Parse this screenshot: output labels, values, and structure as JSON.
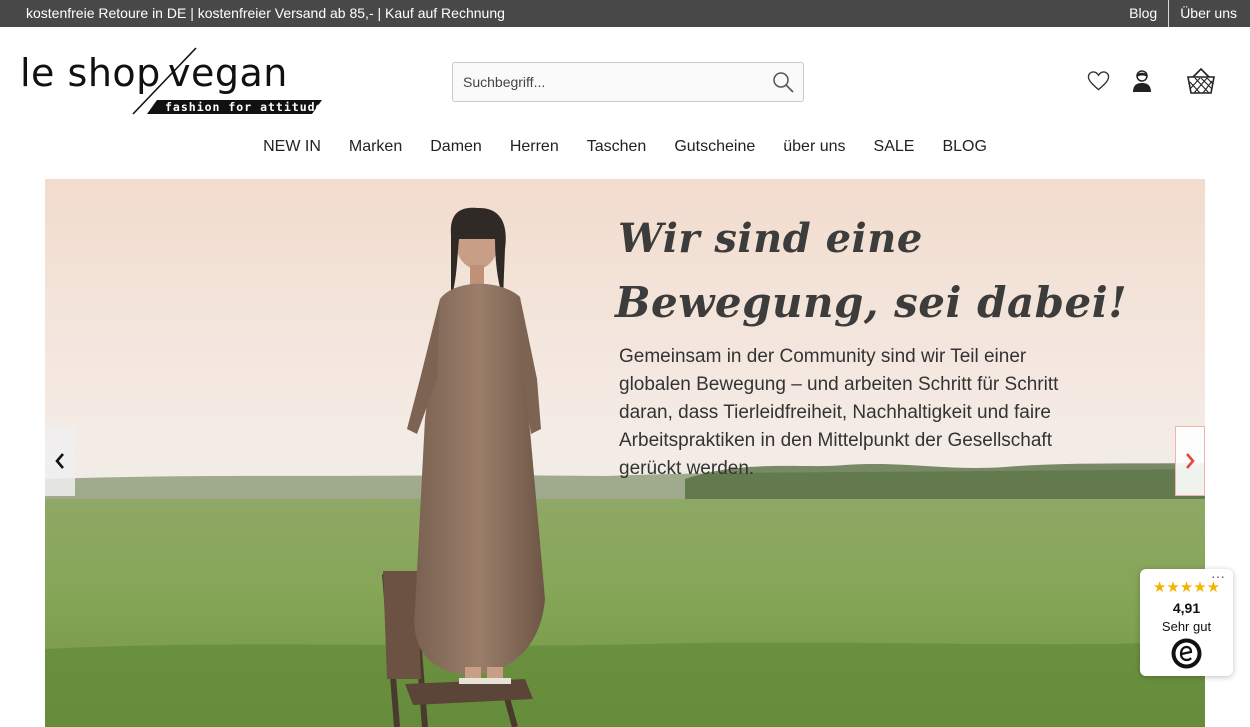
{
  "topbar": {
    "promo": "kostenfreie Retoure in DE | kostenfreier Versand ab 85,- | Kauf auf Rechnung",
    "links": [
      "Blog",
      "Über uns"
    ]
  },
  "logo": {
    "wordmark": "le shop vegan",
    "tagline": "fashion for attitude"
  },
  "search": {
    "placeholder": "Suchbegriff...",
    "icon": "search-icon"
  },
  "header_icons": [
    "heart-icon",
    "account-icon",
    "basket-icon"
  ],
  "nav": {
    "items": [
      "NEW IN",
      "Marken",
      "Damen",
      "Herren",
      "Taschen",
      "Gutscheine",
      "über uns",
      "SALE",
      "BLOG"
    ]
  },
  "hero": {
    "headline_1": "Wir sind eine",
    "headline_2": "Bewegung, sei dabei!",
    "body": "Gemeinsam in der Community sind wir Teil einer globalen Bewegung – und arbeiten Schritt für Schritt daran, dass Tierleidfreiheit, Nachhaltigkeit und faire Arbeitspraktiken in den Mittelpunkt der Gesellschaft gerückt werden.",
    "prev_icon": "chevron-left-icon",
    "next_icon": "chevron-right-icon"
  },
  "trust_badge": {
    "stars": "★★★★★",
    "rating_value": 4.91,
    "score": "4,91",
    "label": "Sehr gut",
    "menu": "···",
    "seal_icon": "trusted-shops-seal-icon"
  },
  "colors": {
    "topbar_bg": "#484848",
    "star": "#f5b301",
    "next_arrow": "#e4463c"
  }
}
